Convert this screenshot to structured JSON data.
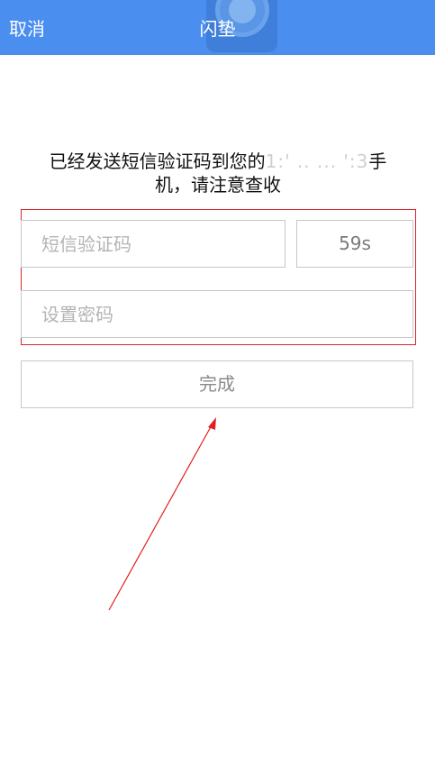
{
  "header": {
    "cancel_label": "取消",
    "title": "闪垫",
    "background": "#4a8ef0"
  },
  "message": {
    "prefix": "已经发送短信验证码到您的",
    "masked_number": "1:'  ..   ...  ':3",
    "suffix_line1": "手",
    "line2": "机，请注意查收"
  },
  "form": {
    "code_placeholder": "短信验证码",
    "countdown": "59s",
    "password_placeholder": "设置密码",
    "done_label": "完成"
  },
  "annotation": {
    "box_color": "#d7262c",
    "arrow_color": "#e02020"
  }
}
